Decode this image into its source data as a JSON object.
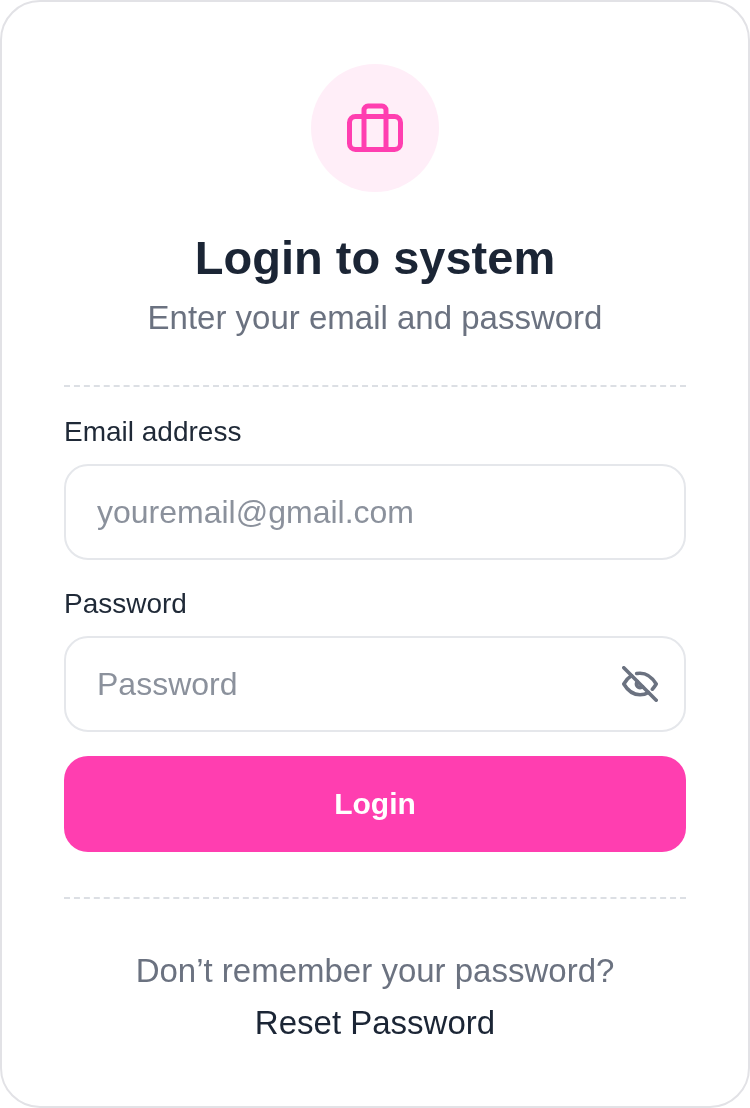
{
  "header": {
    "title": "Login to system",
    "subtitle": "Enter your email and password"
  },
  "fields": [
    {
      "kind": "email",
      "label": "Email address",
      "placeholder": "youremail@gmail.com"
    },
    {
      "kind": "password",
      "label": "Password",
      "placeholder": "Password",
      "revealed": false
    }
  ],
  "submit_button": {
    "label": "Login"
  },
  "footer": {
    "prompt": "Don’t remember your password?",
    "link": "Reset Password"
  }
}
